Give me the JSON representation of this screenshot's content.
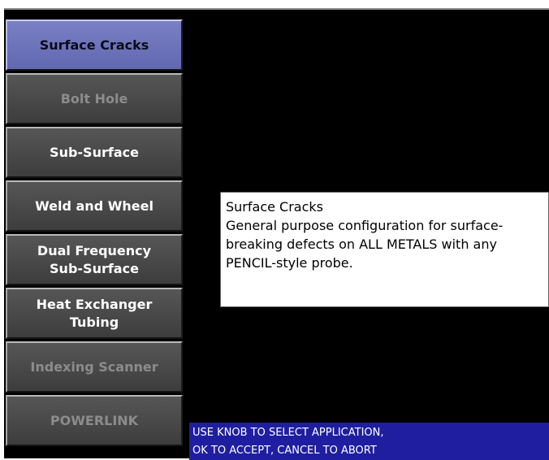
{
  "menu": {
    "items": [
      {
        "label": "Surface Cracks",
        "state": "selected"
      },
      {
        "label": "Bolt Hole",
        "state": "disabled"
      },
      {
        "label": "Sub-Surface",
        "state": "enabled"
      },
      {
        "label": "Weld and Wheel",
        "state": "enabled"
      },
      {
        "label": "Dual Frequency\nSub-Surface",
        "state": "enabled"
      },
      {
        "label": "Heat Exchanger\nTubing",
        "state": "enabled"
      },
      {
        "label": "Indexing Scanner",
        "state": "disabled"
      },
      {
        "label": "POWERLINK",
        "state": "disabled"
      }
    ]
  },
  "description": {
    "title": "Surface Cracks",
    "body": "General purpose configuration for surface-breaking defects on ALL METALS with any PENCIL-style probe."
  },
  "status": {
    "line1": "USE KNOB TO SELECT APPLICATION,",
    "line2": "OK TO ACCEPT, CANCEL TO ABORT"
  },
  "colors": {
    "screen_background": "#000000",
    "selected_button": "#6b71b9",
    "button_background": "#474747",
    "status_bar": "#1f1ea0",
    "description_box": "#ffffff"
  }
}
